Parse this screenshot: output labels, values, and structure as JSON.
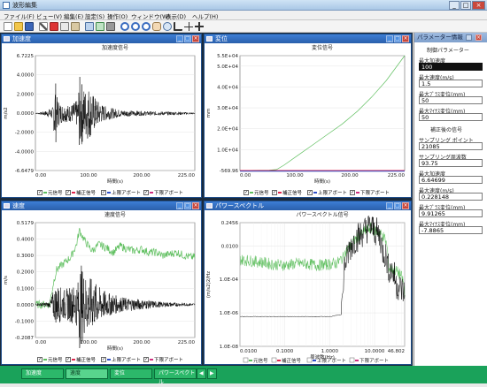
{
  "app": {
    "title": "波形編集"
  },
  "window_controls": {
    "min": "_",
    "max": "□",
    "close": "×"
  },
  "menu": [
    "ファイル(F)",
    "ビュー(V)",
    "編集(E)",
    "設定(S)",
    "操作(O)",
    "ウィンドウ(W)",
    "表示(D)",
    "ヘルプ(H)"
  ],
  "toolbar_icons": [
    "new-file-icon",
    "open-folder-icon",
    "save-icon",
    "cut-icon",
    "delete-icon",
    "copy-icon",
    "paste-icon",
    "sort-icon",
    "wave-icon",
    "tool-icon",
    "zoom-in-icon",
    "zoom-out-icon",
    "zoom-icon",
    "hand-icon",
    "rotate-icon",
    "axis-icon",
    "crosshair-icon",
    "cursor-icon"
  ],
  "colors": {
    "original": "#5fbf5f",
    "corrected": "#e2264d",
    "upper": "#3050c8",
    "lower": "#d03080",
    "signal": "#000000"
  },
  "legend": {
    "original": "元信号",
    "corrected": "補正信号",
    "upper": "上限アボート",
    "lower": "下限アボート"
  },
  "windows": {
    "accel": {
      "title": "加速度",
      "chart_title": "加速度信号",
      "ylabel": "m/s2",
      "xlabel": "時間(s)"
    },
    "disp": {
      "title": "変位",
      "chart_title": "変位信号",
      "ylabel": "mm",
      "xlabel": "時間(s)"
    },
    "vel": {
      "title": "速度",
      "chart_title": "速度信号",
      "ylabel": "m/s",
      "xlabel": "時間(s)"
    },
    "power": {
      "title": "パワースペクトル",
      "chart_title": "パワースペクトル信号",
      "ylabel": "(m/s2)2/Hz",
      "xlabel": "周波数(Hz)"
    }
  },
  "chart_data": [
    {
      "type": "line",
      "title": "加速度信号",
      "xlabel": "時間(s)",
      "ylabel": "m/s2",
      "xlim": [
        0,
        225
      ],
      "ylim": [
        -6.6479,
        6.7225
      ],
      "x_ticks": [
        "0.00",
        "100.00",
        "200.00",
        "225.00"
      ],
      "y_ticks": [
        "6.7225",
        "4.0000",
        "2.0000",
        "0.0000",
        "-2.0000",
        "-4.0000",
        "-6.6479"
      ],
      "series": [
        {
          "name": "補正信号",
          "color": "#000000",
          "envelope": {
            "x": [
              0,
              5,
              15,
              25,
              28,
              30,
              35,
              40,
              50,
              60,
              62,
              65,
              70,
              75,
              80,
              85,
              90,
              95,
              100,
              110,
              120,
              140,
              160,
              180,
              200,
              210,
              225
            ],
            "y": [
              0.05,
              0.1,
              0.3,
              0.8,
              4.6,
              2.0,
              1.2,
              1.0,
              1.0,
              1.6,
              4.5,
              3.8,
              2.8,
              3.2,
              2.4,
              1.8,
              1.3,
              1.0,
              0.8,
              0.6,
              0.4,
              0.3,
              0.25,
              0.22,
              0.2,
              0.15,
              0.1
            ]
          }
        }
      ]
    },
    {
      "type": "line",
      "title": "変位信号",
      "xlabel": "時間(s)",
      "ylabel": "mm",
      "xlim": [
        0,
        225
      ],
      "ylim": [
        -569.96,
        55000
      ],
      "x_ticks": [
        "0.00",
        "100.00",
        "200.00",
        "225.00"
      ],
      "y_ticks": [
        "5.5E+04",
        "5.0E+04",
        "4.0E+04",
        "3.0E+04",
        "2.0E+04",
        "1.0E+04",
        "-569.96"
      ],
      "series": [
        {
          "name": "元信号",
          "color": "#5fbf5f",
          "x": [
            0,
            40,
            50,
            60,
            80,
            100,
            120,
            140,
            160,
            180,
            200,
            225
          ],
          "y": [
            -569.96,
            -400,
            -100,
            2000,
            7000,
            12000,
            17000,
            22000,
            28000,
            35000,
            43000,
            55000
          ]
        },
        {
          "name": "補正信号",
          "color": "#e2264d",
          "x": [
            0,
            225
          ],
          "y": [
            -569.96,
            -569.96
          ]
        },
        {
          "name": "上限アボート",
          "color": "#3050c8",
          "x": [
            0,
            225
          ],
          "y": [
            -900,
            -900
          ]
        }
      ]
    },
    {
      "type": "line",
      "title": "速度信号",
      "xlabel": "時間(s)",
      "ylabel": "m/s",
      "xlim": [
        0,
        225
      ],
      "ylim": [
        -0.2087,
        0.5179
      ],
      "x_ticks": [
        "0.00",
        "100.00",
        "200.00",
        "225.00"
      ],
      "y_ticks": [
        "0.5179",
        "0.4000",
        "0.3000",
        "0.2000",
        "0.1000",
        "0.0000",
        "-0.1000",
        "-0.2087"
      ],
      "series": [
        {
          "name": "元信号",
          "color": "#5fbf5f",
          "x": [
            0,
            20,
            26,
            30,
            40,
            50,
            58,
            62,
            70,
            80,
            90,
            100,
            110,
            120,
            130,
            140,
            150,
            160,
            170,
            180,
            190,
            200,
            210,
            220,
            225
          ],
          "y": [
            0,
            0,
            0.15,
            0.22,
            0.26,
            0.3,
            0.38,
            0.47,
            0.4,
            0.34,
            0.38,
            0.36,
            0.33,
            0.37,
            0.35,
            0.34,
            0.35,
            0.33,
            0.33,
            0.31,
            0.32,
            0.33,
            0.31,
            0.3,
            0.3
          ]
        },
        {
          "name": "補正信号",
          "color": "#000000",
          "envelope": {
            "x": [
              0,
              20,
              26,
              30,
              40,
              50,
              60,
              62,
              70,
              80,
              90,
              100,
              120,
              150,
              180,
              225
            ],
            "y": [
              0.005,
              0.01,
              0.06,
              0.08,
              0.06,
              0.07,
              0.09,
              0.18,
              0.12,
              0.1,
              0.07,
              0.05,
              0.03,
              0.02,
              0.01,
              0.005
            ]
          }
        }
      ]
    },
    {
      "type": "line",
      "title": "パワースペクトル信号",
      "xlabel": "周波数(Hz)",
      "ylabel": "(m/s2)2/Hz",
      "x_scale": "log",
      "y_scale": "log",
      "xlim": [
        0.01,
        46.802
      ],
      "ylim": [
        1e-08,
        0.2456
      ],
      "x_ticks": [
        "0.0100",
        "0.1000",
        "1.0000",
        "10.0000",
        "46.802"
      ],
      "y_ticks": [
        "0.2456",
        "0.0100",
        "1.0E-04",
        "1.0E-06",
        "1.0E-08"
      ],
      "series": [
        {
          "name": "元信号",
          "color": "#5fbf5f",
          "x": [
            0.01,
            0.02,
            0.05,
            0.1,
            0.2,
            0.5,
            1,
            1.5,
            2,
            3,
            5,
            8,
            10,
            20,
            46.8
          ],
          "y": [
            0.0015,
            0.0012,
            0.0008,
            0.0007,
            0.0009,
            0.0007,
            0.0008,
            0.001,
            0.002,
            0.01,
            0.05,
            0.12,
            0.08,
            0.0005,
            1e-05
          ]
        },
        {
          "name": "補正信号",
          "color": "#000000",
          "x": [
            0.01,
            0.1,
            1,
            1.8,
            2,
            2.5,
            3,
            5,
            8,
            10,
            15,
            20,
            30,
            46.8
          ],
          "y": [
            6e-07,
            6e-07,
            6e-07,
            8e-07,
            2e-05,
            0.002,
            0.01,
            0.05,
            0.15,
            0.08,
            0.005,
            0.0005,
            5e-05,
            1e-05
          ]
        }
      ]
    }
  ],
  "param": {
    "title": "パラメーター情報",
    "sec1": "制御パラメーター",
    "fields1": [
      {
        "label": "最大加速度",
        "value": "100",
        "dark": true
      },
      {
        "label": "最大速度(m/s)",
        "value": "1.5",
        "dark": false
      },
      {
        "label": "最大ﾌﾟﾗｽ変位(mm)",
        "value": "50",
        "dark": false
      },
      {
        "label": "最大ﾏｲﾅｽ変位(mm)",
        "value": "50",
        "dark": false
      }
    ],
    "sec2": "補正後の信号",
    "fields2": [
      {
        "label": "サンプリング ポイント",
        "value": "21085",
        "dark": false
      },
      {
        "label": "サンプリング周波数",
        "value": "93.75",
        "dark": false
      },
      {
        "label": "最大加速度",
        "value": "6.64699",
        "dark": false
      },
      {
        "label": "最大速度(m/s)",
        "value": "0.228148",
        "dark": false
      },
      {
        "label": "最大ﾌﾟﾗｽ変位(mm)",
        "value": "9.91265",
        "dark": false
      },
      {
        "label": "最大ﾏｲﾅｽ変位(mm)",
        "value": "-7.8865",
        "dark": false
      }
    ]
  },
  "taskbar": {
    "items": [
      "加速度",
      "速度",
      "変位",
      "パワースペクトル"
    ],
    "active": 1,
    "scroll_left": "◀",
    "scroll_right": "▶"
  }
}
